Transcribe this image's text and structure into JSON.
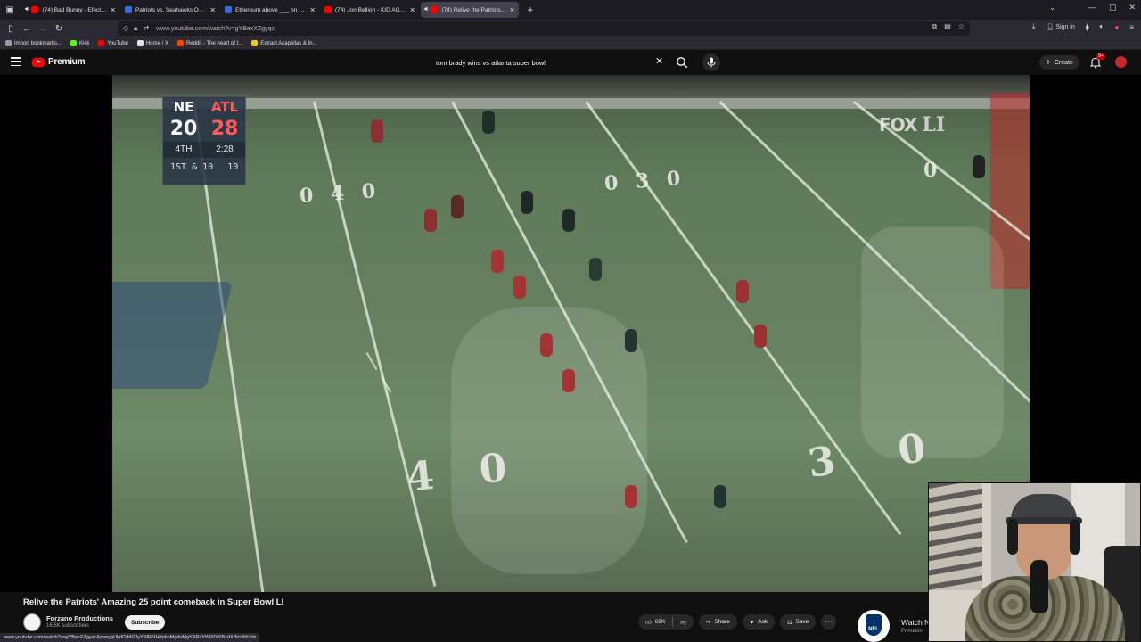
{
  "browser": {
    "tabs": [
      {
        "label": "(74) Bad Bunny - Efecto (Vi",
        "color": "#ff0000",
        "active": false,
        "audio": true
      },
      {
        "label": "Patriots vs. Seahawks Odds & P",
        "color": "#3b6fd8",
        "active": false,
        "audio": false
      },
      {
        "label": "Ethereum above ___ on Februar",
        "color": "#3b6fd8",
        "active": false,
        "audio": false
      },
      {
        "label": "(74) Jon Bellion - KID AGAIN (Vi",
        "color": "#ff0000",
        "active": false,
        "audio": false
      },
      {
        "label": "(74) Relive the Patriots' Am",
        "color": "#ff0000",
        "active": true,
        "audio": true
      }
    ],
    "url": "www.youtube.com/watch?v=gYBexXZgyqc",
    "bookmarks": [
      {
        "label": "Import bookmarks...",
        "color": "#9a9aa6"
      },
      {
        "label": "Kick",
        "color": "#53fc18"
      },
      {
        "label": "YouTube",
        "color": "#ff0000"
      },
      {
        "label": "Home / X",
        "color": "#e6e6e6"
      },
      {
        "label": "Reddit - The heart of t...",
        "color": "#ff4500"
      },
      {
        "label": "Extract Acapellas & In...",
        "color": "#f5c518"
      }
    ],
    "sign_in": "Sign in",
    "status_url": "www.youtube.com/watch?v=gYBexXZgyqc&pp=ygUkdG9tIGJyYWR5IHdpbnMgdnMgYXRsYW50YSBzdXBlciBib3ds"
  },
  "youtube": {
    "brand": "Premium",
    "search_query": "tom brady wins vs atlanta super bowl",
    "create_label": "Create",
    "notif_count": "9+"
  },
  "video": {
    "scorebug": {
      "team1": "NE",
      "team2": "ATL",
      "score1": "20",
      "score2": "28",
      "quarter": "4TH",
      "clock": "2:28",
      "down": "1ST & 10",
      "down_suffix": "10"
    },
    "network": "FOX",
    "event_mark": "LI",
    "yard_numbers": {
      "left_top": "0 4 0",
      "mid_top": "0 3 0",
      "right_top": "0",
      "bottom_left": "4 0",
      "bottom_right": "3 0"
    }
  },
  "meta": {
    "title": "Relive the Patriots' Amazing 25 point comeback in Super Bowl LI",
    "channel": "Forzano Productions",
    "subscribers": "16.5K subscribers",
    "subscribe_label": "Subscribe",
    "likes": "69K",
    "share_label": "Share",
    "ask_label": "Ask",
    "save_label": "Save"
  },
  "sidecard": {
    "title": "Watch N",
    "subtitle": "Primetim",
    "logo_text": "NFL"
  }
}
